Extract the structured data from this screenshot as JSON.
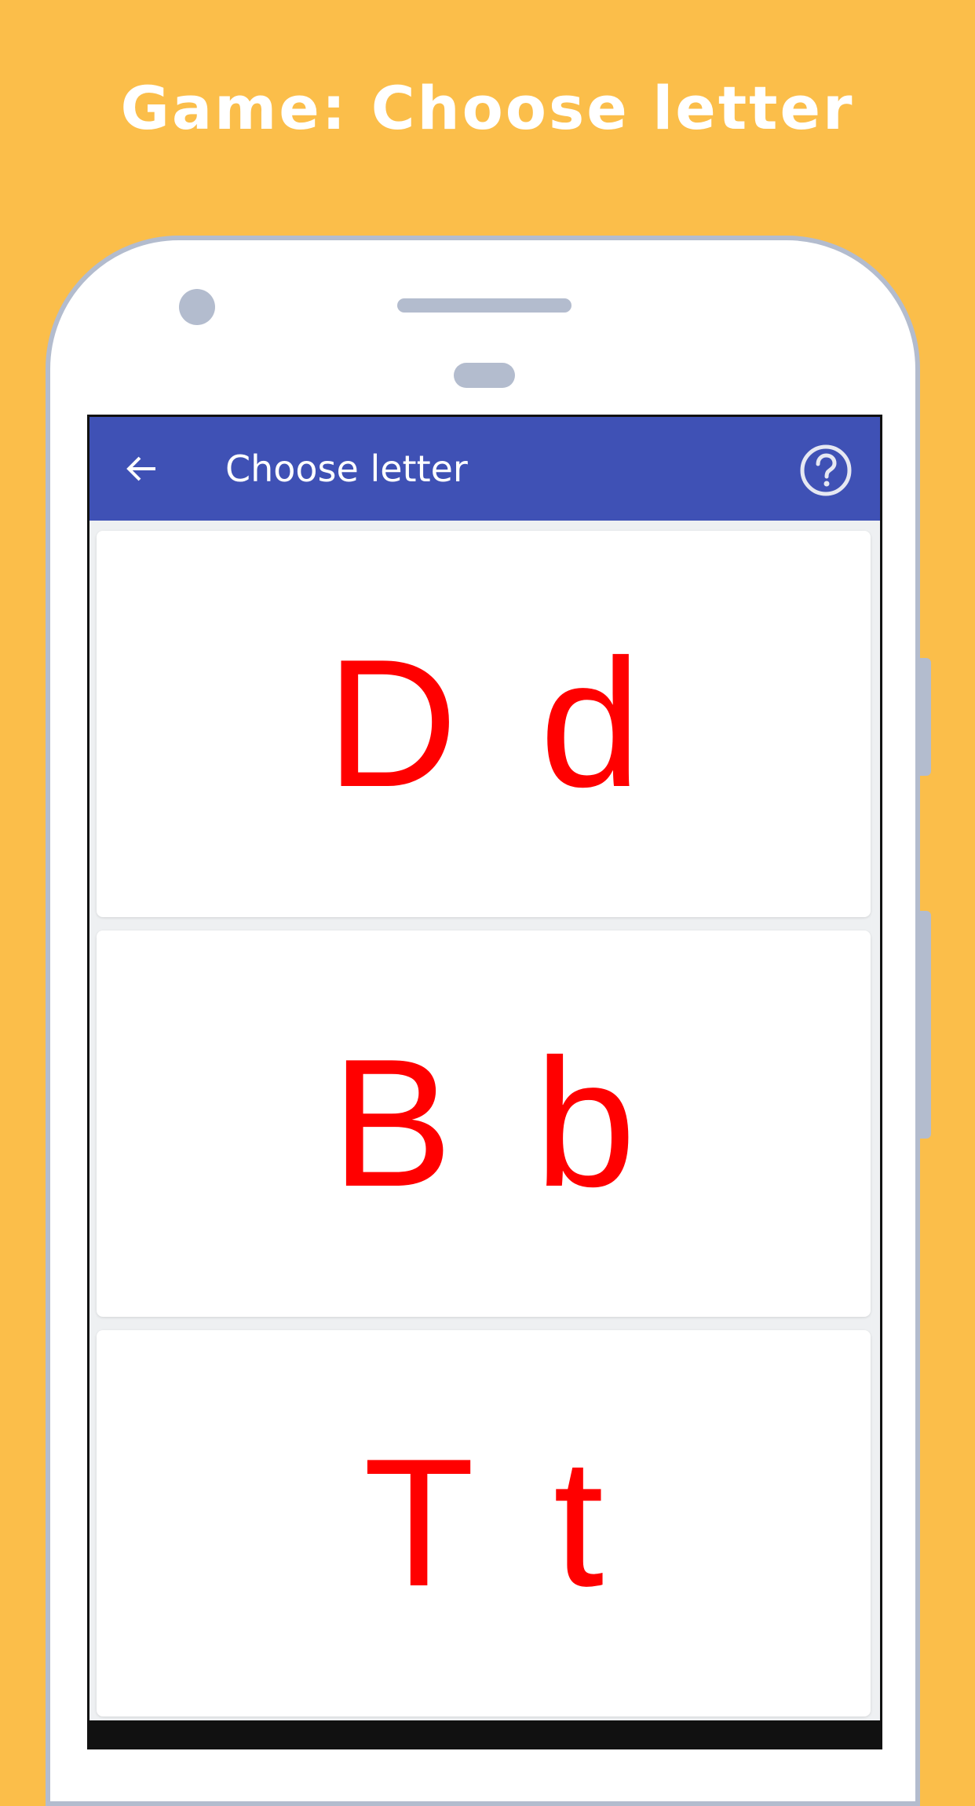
{
  "promo": {
    "title": "Game: Choose letter"
  },
  "app_bar": {
    "title": "Choose letter",
    "back_icon": "arrow-left-icon",
    "help_icon": "help-circle-icon"
  },
  "cards": [
    {
      "text": "D d"
    },
    {
      "text": "B b"
    },
    {
      "text": "T t"
    }
  ],
  "colors": {
    "background": "#FBBE4A",
    "app_bar": "#3F51B5",
    "letter": "#FF0000",
    "phone_frame": "#B3BCCE"
  }
}
